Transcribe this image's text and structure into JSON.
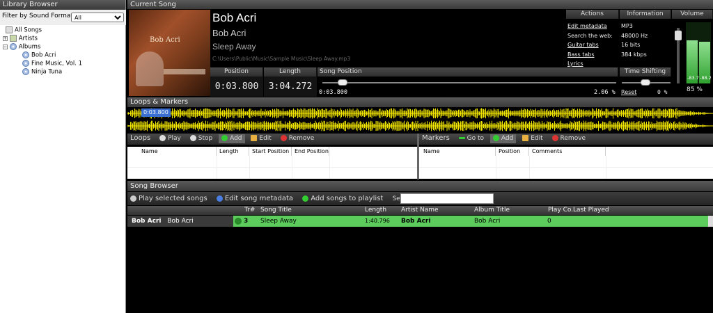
{
  "library": {
    "title": "Library Browser",
    "filter_label": "Filter by Sound Format:",
    "filter_value": "All",
    "tree": [
      {
        "label": "All Songs"
      },
      {
        "label": "Artists"
      },
      {
        "label": "Albums"
      },
      {
        "label": "Bob Acri"
      },
      {
        "label": "Fine Music, Vol. 1"
      },
      {
        "label": "Ninja Tuna"
      }
    ]
  },
  "current_song": {
    "title": "Current Song",
    "artist": "Bob Acri",
    "album": "Bob Acri",
    "song": "Sleep Away",
    "path": "C:\\Users\\Public\\Music\\Sample Music\\Sleep Away.mp3",
    "album_art_text": "Bob Acri",
    "position_label": "Position",
    "position_value": "0:03.800",
    "length_label": "Length",
    "length_value": "3:04.272",
    "song_position_label": "Song Position",
    "song_position_time": "0:03.800",
    "song_position_pct": "2.06 %",
    "song_position_fraction": 0.0206
  },
  "actions": {
    "title": "Actions",
    "edit_metadata": "Edit metadata",
    "search_web": "Search the web:",
    "guitar_tabs": "Guitar tabs",
    "bass_tabs": "Bass tabs",
    "lyrics": "Lyrics"
  },
  "information": {
    "title": "Information",
    "format": "MP3",
    "sample_rate": "48000 Hz",
    "bits": "16 bits",
    "bitrate": "384 kbps"
  },
  "volume": {
    "title": "Volume",
    "left_db": "-83.7",
    "right_db": "-88.2",
    "percent": "85 %",
    "level": 0.85
  },
  "time_shifting": {
    "title": "Time Shifting",
    "reset": "Reset",
    "percent": "0 %"
  },
  "loops_markers": {
    "title": "Loops & Markers",
    "marker_time": "0:03.800"
  },
  "loops": {
    "title": "Loops",
    "play": "Play",
    "stop": "Stop",
    "add": "Add",
    "edit": "Edit",
    "remove": "Remove",
    "columns": [
      "Name",
      "Length",
      "Start Position",
      "End Position"
    ]
  },
  "markers": {
    "title": "Markers",
    "goto": "Go to",
    "add": "Add",
    "edit": "Edit",
    "remove": "Remove",
    "columns": [
      "Name",
      "Position",
      "Comments"
    ]
  },
  "song_browser": {
    "title": "Song Browser",
    "play_selected": "Play selected songs",
    "edit_metadata": "Edit song metadata",
    "add_to_playlist": "Add songs to playlist",
    "search_label": "Search for :",
    "search_value": "",
    "columns": [
      "Tr#",
      "Song Title",
      "Length",
      "Artist Name",
      "Album Title",
      "Play Co...",
      "Last Played"
    ],
    "group_artist": "Bob Acri",
    "group_album": "Bob Acri",
    "rows": [
      {
        "track": "3",
        "title": "Sleep Away",
        "length": "1:40.796",
        "artist": "Bob Acri",
        "album": "Bob Acri",
        "play_count": "0",
        "last_played": ""
      }
    ]
  },
  "colors": {
    "waveform": "#f2e600",
    "selected_row": "#5ccc5c",
    "meter": "#3fbf3f"
  }
}
